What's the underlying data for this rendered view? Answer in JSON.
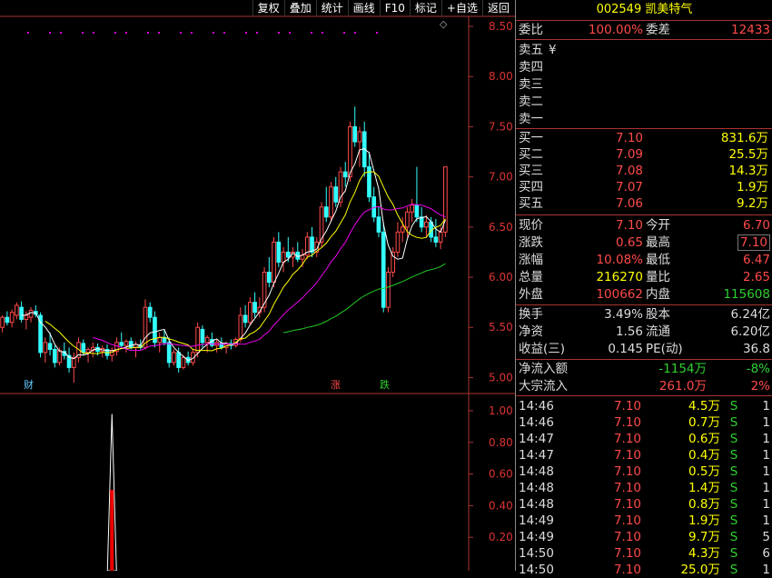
{
  "toolbar": [
    "复权",
    "叠加",
    "统计",
    "画线",
    "F10",
    "标记",
    "+自选",
    "返回"
  ],
  "chart_data": {
    "type": "candlestick",
    "y_ticks": [
      "8.50",
      "8.00",
      "7.50",
      "7.00",
      "6.50",
      "6.00",
      "5.50",
      "5.00"
    ],
    "ylim": [
      4.85,
      8.6
    ],
    "volume_y_ticks": [
      "1.00",
      "0.80",
      "0.60",
      "0.40",
      "0.20"
    ],
    "markers": [
      {
        "label": "财",
        "color": "#6cf"
      },
      {
        "label": "涨",
        "color": "#ff4a4a"
      },
      {
        "label": "跌",
        "color": "#2fd02f"
      }
    ],
    "candles": [
      [
        5.5,
        5.62,
        5.45,
        5.6
      ],
      [
        5.6,
        5.66,
        5.52,
        5.55
      ],
      [
        5.55,
        5.68,
        5.5,
        5.65
      ],
      [
        5.62,
        5.75,
        5.58,
        5.72
      ],
      [
        5.7,
        5.76,
        5.55,
        5.58
      ],
      [
        5.58,
        5.66,
        5.48,
        5.62
      ],
      [
        5.6,
        5.7,
        5.55,
        5.67
      ],
      [
        5.66,
        5.72,
        5.6,
        5.63
      ],
      [
        5.62,
        5.65,
        5.2,
        5.25
      ],
      [
        5.25,
        5.4,
        5.15,
        5.35
      ],
      [
        5.34,
        5.45,
        5.22,
        5.28
      ],
      [
        5.28,
        5.32,
        5.1,
        5.15
      ],
      [
        5.15,
        5.3,
        5.12,
        5.27
      ],
      [
        5.26,
        5.35,
        5.18,
        5.22
      ],
      [
        5.22,
        5.3,
        5.05,
        5.1
      ],
      [
        5.1,
        5.25,
        4.95,
        5.2
      ],
      [
        5.2,
        5.4,
        5.15,
        5.35
      ],
      [
        5.34,
        5.38,
        5.22,
        5.25
      ],
      [
        5.25,
        5.3,
        5.15,
        5.28
      ],
      [
        5.27,
        5.35,
        5.2,
        5.3
      ],
      [
        5.3,
        5.34,
        5.22,
        5.26
      ],
      [
        5.26,
        5.32,
        5.2,
        5.29
      ],
      [
        5.28,
        5.33,
        5.18,
        5.22
      ],
      [
        5.22,
        5.3,
        5.16,
        5.27
      ],
      [
        5.26,
        5.4,
        5.22,
        5.35
      ],
      [
        5.35,
        5.45,
        5.3,
        5.32
      ],
      [
        5.32,
        5.38,
        5.25,
        5.36
      ],
      [
        5.36,
        5.4,
        5.28,
        5.3
      ],
      [
        5.3,
        5.36,
        5.2,
        5.33
      ],
      [
        5.32,
        5.38,
        5.28,
        5.3
      ],
      [
        5.3,
        5.78,
        5.28,
        5.7
      ],
      [
        5.7,
        5.75,
        5.55,
        5.6
      ],
      [
        5.6,
        5.66,
        5.3,
        5.35
      ],
      [
        5.35,
        5.45,
        5.25,
        5.4
      ],
      [
        5.4,
        5.48,
        5.32,
        5.35
      ],
      [
        5.35,
        5.4,
        5.1,
        5.15
      ],
      [
        5.15,
        5.28,
        5.12,
        5.25
      ],
      [
        5.25,
        5.3,
        5.05,
        5.1
      ],
      [
        5.1,
        5.22,
        5.08,
        5.2
      ],
      [
        5.2,
        5.26,
        5.12,
        5.15
      ],
      [
        5.15,
        5.28,
        5.12,
        5.25
      ],
      [
        5.25,
        5.55,
        5.2,
        5.5
      ],
      [
        5.48,
        5.52,
        5.3,
        5.35
      ],
      [
        5.35,
        5.42,
        5.25,
        5.4
      ],
      [
        5.38,
        5.45,
        5.3,
        5.32
      ],
      [
        5.32,
        5.38,
        5.25,
        5.35
      ],
      [
        5.34,
        5.4,
        5.28,
        5.3
      ],
      [
        5.3,
        5.36,
        5.24,
        5.34
      ],
      [
        5.34,
        5.38,
        5.28,
        5.32
      ],
      [
        5.32,
        5.4,
        5.3,
        5.38
      ],
      [
        5.38,
        5.7,
        5.35,
        5.62
      ],
      [
        5.62,
        5.72,
        5.5,
        5.55
      ],
      [
        5.55,
        5.8,
        5.52,
        5.75
      ],
      [
        5.75,
        5.85,
        5.6,
        5.65
      ],
      [
        5.65,
        5.8,
        5.6,
        5.7
      ],
      [
        5.7,
        6.1,
        5.65,
        6.05
      ],
      [
        6.05,
        6.2,
        5.9,
        5.95
      ],
      [
        5.95,
        6.4,
        5.9,
        6.35
      ],
      [
        6.35,
        6.45,
        6.1,
        6.15
      ],
      [
        6.15,
        6.3,
        6.05,
        6.25
      ],
      [
        6.25,
        6.4,
        6.15,
        6.2
      ],
      [
        6.2,
        6.3,
        6.1,
        6.25
      ],
      [
        6.25,
        6.35,
        6.15,
        6.18
      ],
      [
        6.18,
        6.28,
        6.1,
        6.22
      ],
      [
        6.22,
        6.45,
        6.18,
        6.4
      ],
      [
        6.4,
        6.5,
        6.2,
        6.25
      ],
      [
        6.25,
        6.4,
        6.2,
        6.35
      ],
      [
        6.35,
        6.75,
        6.3,
        6.7
      ],
      [
        6.7,
        6.9,
        6.55,
        6.6
      ],
      [
        6.6,
        6.95,
        6.55,
        6.9
      ],
      [
        6.9,
        7.0,
        6.7,
        6.75
      ],
      [
        6.75,
        7.1,
        6.7,
        7.05
      ],
      [
        7.05,
        7.15,
        6.9,
        7.0
      ],
      [
        7.0,
        7.55,
        6.95,
        7.5
      ],
      [
        7.5,
        7.7,
        7.3,
        7.35
      ],
      [
        7.35,
        7.5,
        7.1,
        7.45
      ],
      [
        7.45,
        7.55,
        7.0,
        7.1
      ],
      [
        7.1,
        7.25,
        6.75,
        6.8
      ],
      [
        6.8,
        6.9,
        6.55,
        6.6
      ],
      [
        6.6,
        6.7,
        6.4,
        6.45
      ],
      [
        6.45,
        6.55,
        5.65,
        5.7
      ],
      [
        5.7,
        6.1,
        5.65,
        6.05
      ],
      [
        6.05,
        6.3,
        6.0,
        6.25
      ],
      [
        6.25,
        6.55,
        6.2,
        6.45
      ],
      [
        6.45,
        6.6,
        6.35,
        6.5
      ],
      [
        6.5,
        6.7,
        6.4,
        6.65
      ],
      [
        6.65,
        6.78,
        6.55,
        6.72
      ],
      [
        6.72,
        7.1,
        6.55,
        6.6
      ],
      [
        6.6,
        6.7,
        6.45,
        6.5
      ],
      [
        6.5,
        6.62,
        6.4,
        6.55
      ],
      [
        6.55,
        6.6,
        6.35,
        6.4
      ],
      [
        6.4,
        6.58,
        6.3,
        6.35
      ],
      [
        6.35,
        6.5,
        6.28,
        6.45
      ],
      [
        6.45,
        7.1,
        6.4,
        7.1
      ]
    ],
    "volumes": [
      0.05,
      0.05,
      0.04,
      0.05,
      0.04,
      0.04,
      0.04,
      0.05,
      0.05,
      0.04,
      0.05,
      0.05,
      0.04,
      0.04,
      0.05,
      0.04,
      0.05,
      0.06,
      0.07,
      0.08,
      0.1,
      0.12,
      0.3,
      0.98,
      0.5,
      0.2,
      0.08,
      0.05,
      0.04,
      0.04,
      0.04,
      0.04,
      0.04,
      0.04,
      0.04,
      0.04,
      0.04,
      0.04,
      0.04,
      0.04,
      0.04,
      0.04,
      0.04,
      0.04,
      0.04,
      0.04,
      0.04,
      0.04,
      0.04,
      0.04,
      0.04,
      0.04,
      0.04,
      0.04,
      0.04,
      0.04,
      0.04,
      0.04,
      0.04,
      0.04,
      0.04,
      0.04,
      0.04,
      0.04,
      0.04,
      0.04,
      0.04,
      0.04,
      0.04,
      0.04,
      0.04,
      0.04,
      0.04,
      0.04,
      0.04,
      0.04,
      0.04,
      0.04,
      0.04,
      0.04,
      0.04,
      0.04,
      0.04,
      0.04,
      0.04,
      0.04,
      0.04,
      0.04,
      0.04,
      0.04,
      0.04,
      0.04,
      0.04,
      0.04
    ]
  },
  "stock": {
    "code": "002549",
    "name": "凯美特气"
  },
  "weibi": {
    "label": "委比",
    "value": "100.00%",
    "label2": "委差",
    "value2": "12433"
  },
  "sell": [
    {
      "label": "卖五",
      "price": "",
      "vol": "",
      "extra": "¥"
    },
    {
      "label": "卖四",
      "price": "",
      "vol": "",
      "extra": ""
    },
    {
      "label": "卖三",
      "price": "",
      "vol": "",
      "extra": ""
    },
    {
      "label": "卖二",
      "price": "",
      "vol": "",
      "extra": ""
    },
    {
      "label": "卖一",
      "price": "",
      "vol": "",
      "extra": ""
    }
  ],
  "buy": [
    {
      "label": "买一",
      "price": "7.10",
      "vol": "831.6万"
    },
    {
      "label": "买二",
      "price": "7.09",
      "vol": "25.5万"
    },
    {
      "label": "买三",
      "price": "7.08",
      "vol": "14.3万"
    },
    {
      "label": "买四",
      "price": "7.07",
      "vol": "1.9万"
    },
    {
      "label": "买五",
      "price": "7.06",
      "vol": "9.2万"
    }
  ],
  "quote": [
    {
      "l1": "现价",
      "v1": "7.10",
      "c1": "r",
      "l2": "今开",
      "v2": "6.70",
      "c2": "r",
      "box": false
    },
    {
      "l1": "涨跌",
      "v1": "0.65",
      "c1": "r",
      "l2": "最高",
      "v2": "7.10",
      "c2": "r",
      "box": true
    },
    {
      "l1": "涨幅",
      "v1": "10.08%",
      "c1": "r",
      "l2": "最低",
      "v2": "6.47",
      "c2": "r",
      "box": false
    },
    {
      "l1": "总量",
      "v1": "216270",
      "c1": "y",
      "l2": "量比",
      "v2": "2.65",
      "c2": "r",
      "box": false
    },
    {
      "l1": "外盘",
      "v1": "100662",
      "c1": "r",
      "l2": "内盘",
      "v2": "115608",
      "c2": "g",
      "box": false
    }
  ],
  "finance": [
    {
      "l1": "换手",
      "v1": "3.49%",
      "l2": "股本",
      "v2": "6.24亿"
    },
    {
      "l1": "净资",
      "v1": "1.56",
      "l2": "流通",
      "v2": "6.20亿"
    },
    {
      "l1": "收益(三)",
      "v1": "0.145",
      "l2": "PE(动)",
      "v2": "36.8"
    }
  ],
  "flow": [
    {
      "label": "净流入额",
      "value": "-1154万",
      "value_color": "g",
      "pct": "-8%",
      "pct_color": "g"
    },
    {
      "label": "大宗流入",
      "value": "261.0万",
      "value_color": "r",
      "pct": "2%",
      "pct_color": "r"
    }
  ],
  "ticks": [
    {
      "time": "14:46",
      "price": "7.10",
      "vol": "4.5万",
      "side": "S",
      "n": "1"
    },
    {
      "time": "14:46",
      "price": "7.10",
      "vol": "0.7万",
      "side": "S",
      "n": "1"
    },
    {
      "time": "14:47",
      "price": "7.10",
      "vol": "0.6万",
      "side": "S",
      "n": "1"
    },
    {
      "time": "14:47",
      "price": "7.10",
      "vol": "0.4万",
      "side": "S",
      "n": "1"
    },
    {
      "time": "14:48",
      "price": "7.10",
      "vol": "0.5万",
      "side": "S",
      "n": "1"
    },
    {
      "time": "14:48",
      "price": "7.10",
      "vol": "1.4万",
      "side": "S",
      "n": "1"
    },
    {
      "time": "14:48",
      "price": "7.10",
      "vol": "0.8万",
      "side": "S",
      "n": "1"
    },
    {
      "time": "14:49",
      "price": "7.10",
      "vol": "1.9万",
      "side": "S",
      "n": "1"
    },
    {
      "time": "14:49",
      "price": "7.10",
      "vol": "9.7万",
      "side": "S",
      "n": "5"
    },
    {
      "time": "14:50",
      "price": "7.10",
      "vol": "4.3万",
      "side": "S",
      "n": "6"
    },
    {
      "time": "14:50",
      "price": "7.10",
      "vol": "25.0万",
      "side": "S",
      "n": "1"
    }
  ]
}
